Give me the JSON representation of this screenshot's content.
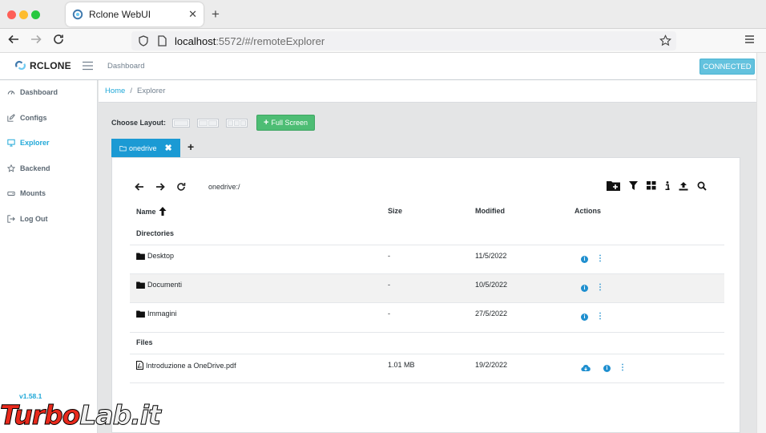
{
  "browser": {
    "tab_title": "Rclone WebUI",
    "url_host": "localhost",
    "url_rest": ":5572/#/remoteExplorer"
  },
  "header": {
    "logo_text": "RCLONE",
    "link": "Dashboard",
    "status": "CONNECTED"
  },
  "sidebar": {
    "items": [
      {
        "label": "Dashboard",
        "icon": "speedometer-icon"
      },
      {
        "label": "Configs",
        "icon": "edit-icon"
      },
      {
        "label": "Explorer",
        "icon": "monitor-icon",
        "active": true
      },
      {
        "label": "Backend",
        "icon": "star-icon"
      },
      {
        "label": "Mounts",
        "icon": "drive-icon"
      },
      {
        "label": "Log Out",
        "icon": "logout-icon"
      }
    ],
    "version": "v1.58.1"
  },
  "breadcrumb": {
    "home": "Home",
    "separator": "/",
    "current": "Explorer"
  },
  "layout": {
    "label": "Choose Layout:",
    "fullscreen": "Full Screen"
  },
  "remote_tab": {
    "label": "onedrive"
  },
  "explorer": {
    "path": "onedrive:/",
    "columns": {
      "name": "Name",
      "size": "Size",
      "modified": "Modified",
      "actions": "Actions"
    },
    "directories_label": "Directories",
    "files_label": "Files",
    "directories": [
      {
        "name": "Desktop",
        "size": "-",
        "modified": "11/5/2022"
      },
      {
        "name": "Documenti",
        "size": "-",
        "modified": "10/5/2022"
      },
      {
        "name": "Immagini",
        "size": "-",
        "modified": "27/5/2022"
      }
    ],
    "files": [
      {
        "name": "Introduzione a OneDrive.pdf",
        "size": "1.01 MB",
        "modified": "19/2/2022"
      }
    ]
  },
  "watermark": {
    "part1": "Turbo",
    "part2": "Lab.it"
  },
  "colors": {
    "accent": "#20a8d8",
    "success": "#4dbd74",
    "info": "#63c2de",
    "tab": "#1b9ad4"
  }
}
